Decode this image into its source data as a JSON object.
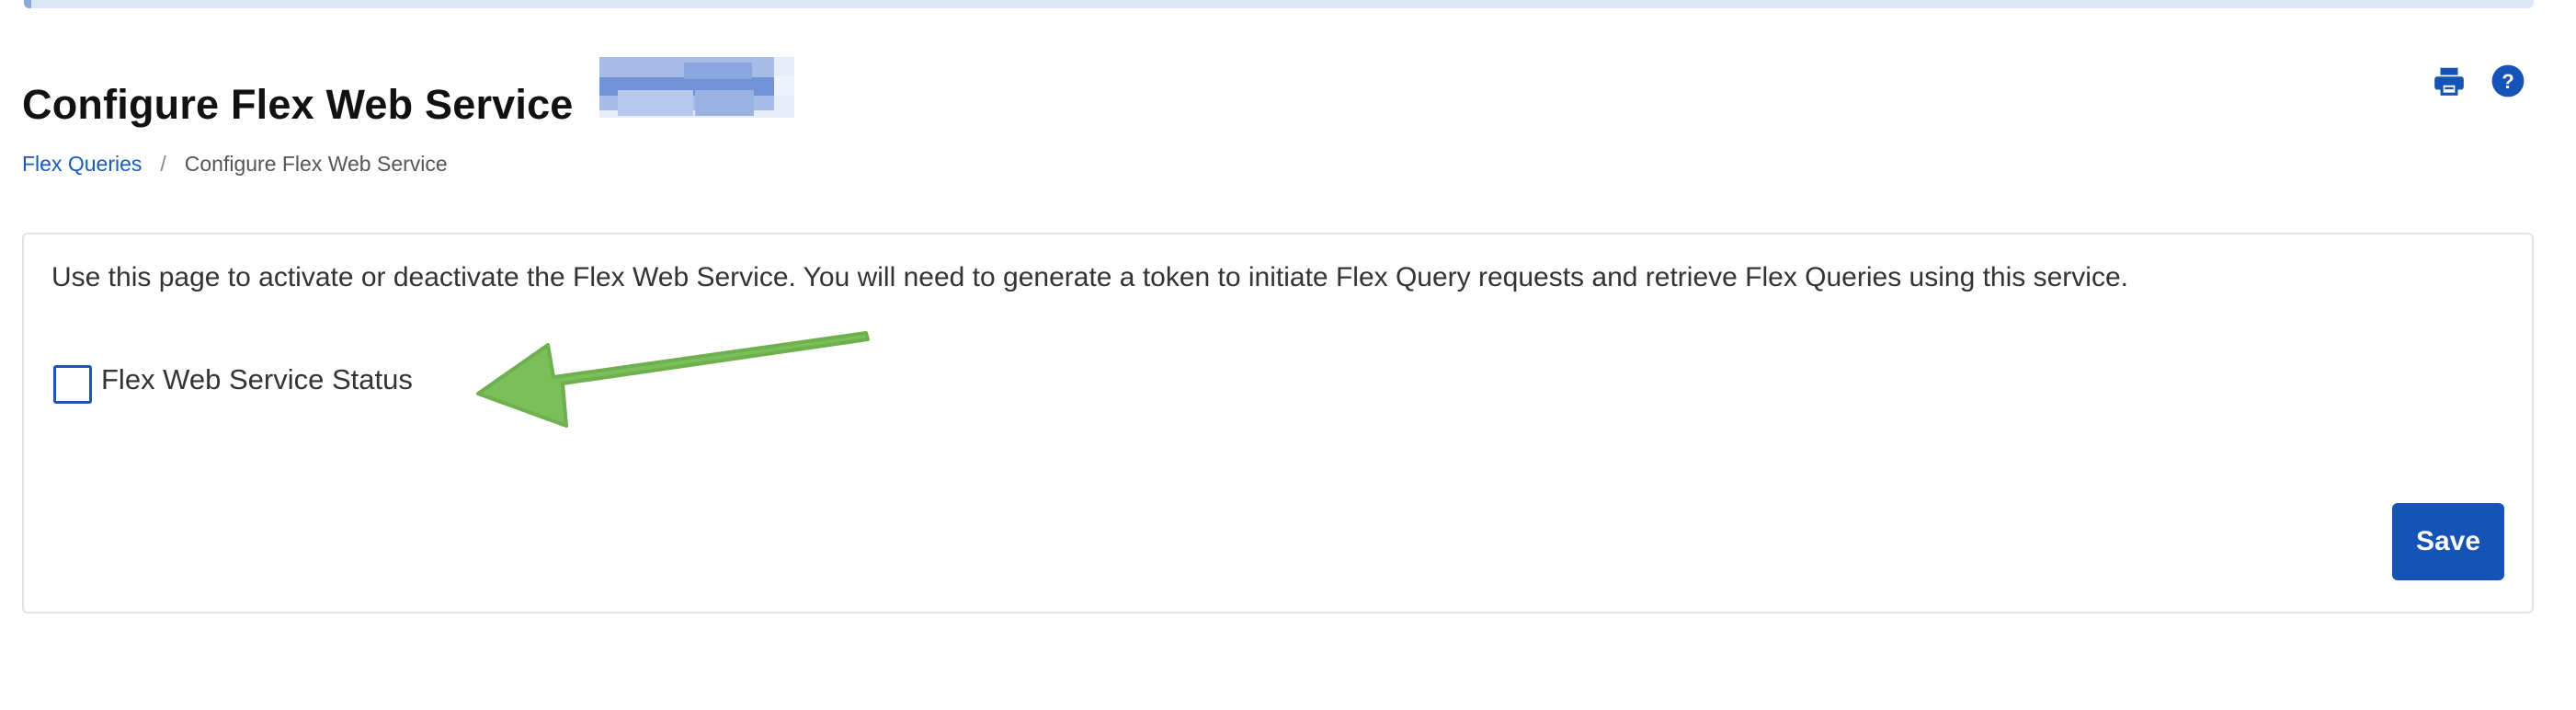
{
  "page": {
    "title": "Configure Flex Web Service"
  },
  "toolbar": {
    "print_icon": "printer-icon",
    "help_icon": "question-circle-icon",
    "help_glyph": "?"
  },
  "breadcrumb": {
    "items": [
      {
        "label": "Flex Queries",
        "link": true
      },
      {
        "label": "Configure Flex Web Service",
        "link": false
      }
    ],
    "separator": "/"
  },
  "card": {
    "description": "Use this page to activate or deactivate the Flex Web Service. You will need to generate a token to initiate Flex Query requests and retrieve Flex Queries using this service.",
    "status_checkbox": {
      "label": "Flex Web Service Status",
      "checked": false
    },
    "save_label": "Save"
  },
  "colors": {
    "accent": "#1553b6",
    "link": "#1a5bb8",
    "annotation_arrow": "#7bbf5a"
  }
}
